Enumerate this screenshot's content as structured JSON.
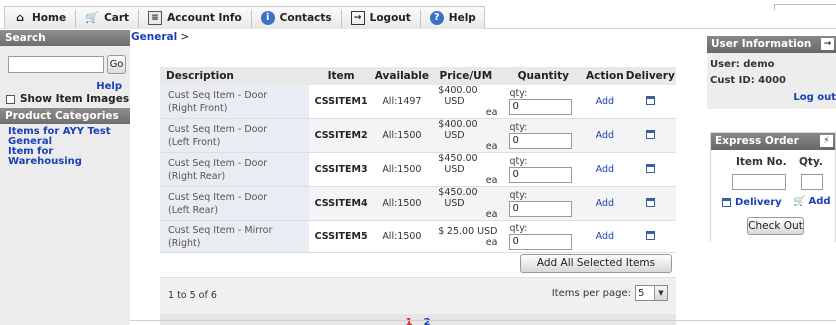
{
  "nav": {
    "home": "Home",
    "cart": "Cart",
    "account": "Account Info",
    "contacts": "Contacts",
    "logout": "Logout",
    "help": "Help"
  },
  "sidebar": {
    "search_title": "Search",
    "search_value": "",
    "go_label": "Go",
    "help_label": "Help",
    "show_images_label": "Show Item Images",
    "categories_title": "Product Categories",
    "categories": [
      "Items for AYY Test",
      "General",
      "Item for Warehousing"
    ]
  },
  "breadcrumb": {
    "current": "General",
    "separator": ">"
  },
  "table": {
    "headers": {
      "description": "Description",
      "item": "Item",
      "available": "Available",
      "price": "Price/UM",
      "quantity": "Quantity",
      "action": "Action",
      "delivery": "Delivery"
    },
    "qty_label": "qty:",
    "rows": [
      {
        "desc1": "Cust Seq Item - Door",
        "desc2": "(Right Front)",
        "item": "CSSITEM1",
        "available": "All:1497",
        "currency": "$",
        "price": "400.00 USD",
        "unit": "ea",
        "qty": "0",
        "action": "Add"
      },
      {
        "desc1": "Cust Seq Item - Door",
        "desc2": "(Left Front)",
        "item": "CSSITEM2",
        "available": "All:1500",
        "currency": "$",
        "price": "400.00 USD",
        "unit": "ea",
        "qty": "0",
        "action": "Add"
      },
      {
        "desc1": "Cust Seq Item - Door",
        "desc2": "(Right Rear)",
        "item": "CSSITEM3",
        "available": "All:1500",
        "currency": "$",
        "price": "450.00 USD",
        "unit": "ea",
        "qty": "0",
        "action": "Add"
      },
      {
        "desc1": "Cust Seq Item - Door",
        "desc2": "(Left Rear)",
        "item": "CSSITEM4",
        "available": "All:1500",
        "currency": "$",
        "price": "450.00 USD",
        "unit": "ea",
        "qty": "0",
        "action": "Add"
      },
      {
        "desc1": "Cust Seq Item - Mirror",
        "desc2": "(Right)",
        "item": "CSSITEM5",
        "available": "All:1500",
        "currency": "$",
        "price": "25.00 USD",
        "unit": "ea",
        "qty": "0",
        "action": "Add"
      }
    ],
    "add_all_label": "Add All Selected Items"
  },
  "pager": {
    "range_text": "1 to 5 of 6",
    "items_per_page_label": "Items per page:",
    "items_per_page_value": "5",
    "pages": [
      "1",
      "2"
    ],
    "current_page": "1"
  },
  "user_info": {
    "title": "User Information",
    "user": "User: demo",
    "cust_id": "Cust ID: 4000",
    "logout_label": "Log out"
  },
  "express_order": {
    "title": "Express Order",
    "item_no_label": "Item No.",
    "qty_label": "Qty.",
    "delivery_label": "Delivery",
    "add_label": "Add",
    "checkout_label": "Check Out"
  },
  "colors": {
    "link": "#1a3fb8",
    "header_bg": "#7a7a7a",
    "current_page": "#cc2222"
  }
}
